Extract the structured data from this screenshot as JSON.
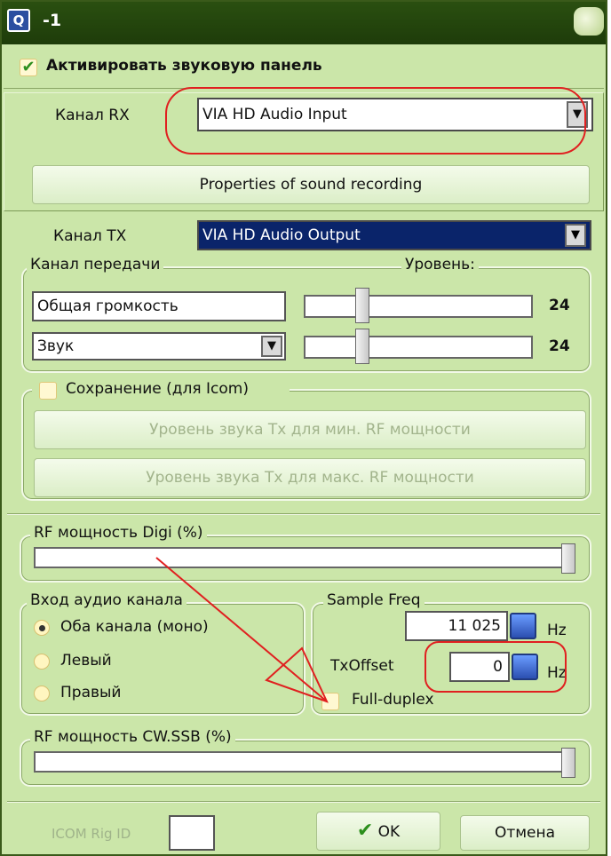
{
  "window": {
    "title": "-1",
    "icon_char": "Q",
    "accent": "#2a4f10",
    "annotation_color": "#e02020"
  },
  "activate": {
    "label": "Активировать звуковую панель",
    "checked": true
  },
  "rx": {
    "label": "Канал RX",
    "value": "VIA HD Audio Input",
    "properties_button": "Properties of sound recording"
  },
  "tx": {
    "label": "Канал TX",
    "value": "VIA HD Audio Output"
  },
  "transmit": {
    "legend": "Канал передачи",
    "level_label": "Уровень:",
    "rows": [
      {
        "name": "Общая громкость",
        "level": 24
      },
      {
        "name": "Звук",
        "level": 24
      }
    ]
  },
  "icom_save": {
    "label": "Сохранение (для Icom)",
    "checked": false,
    "min_button": "Уровень звука Tx для мин. RF мощности",
    "max_button": "Уровень звука Tx для макс. RF мощности"
  },
  "rf_digi": {
    "label": "RF мощность Digi (%)",
    "value_fraction": 1.0
  },
  "audio_input": {
    "legend": "Вход аудио канала",
    "options": [
      "Оба канала (моно)",
      "Левый",
      "Правый"
    ],
    "selected": 0
  },
  "sample": {
    "legend": "Sample Freq",
    "freq": "11 025",
    "unit": "Hz",
    "txoffset_label": "TxOffset",
    "txoffset": "0",
    "fullduplex_label": "Full-duplex"
  },
  "rf_cw": {
    "label": "RF мощность CW.SSB (%)",
    "value_fraction": 1.0
  },
  "footer": {
    "rig_id_label": "ICOM Rig ID",
    "rig_id": "",
    "ok": "OK",
    "cancel": "Отмена"
  }
}
